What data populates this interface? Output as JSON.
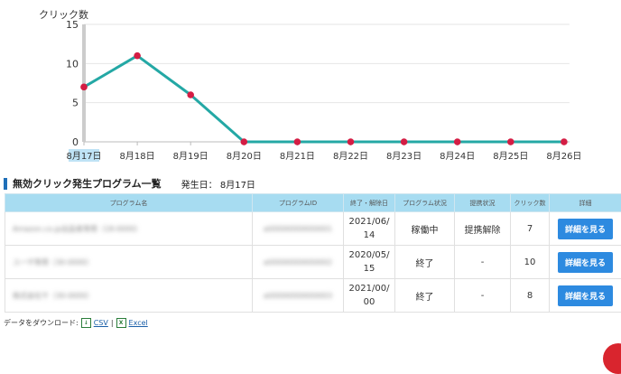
{
  "chart_data": {
    "type": "line",
    "ylabel": "クリック数",
    "categories": [
      "8月17日",
      "8月18日",
      "8月19日",
      "8月20日",
      "8月21日",
      "8月22日",
      "8月23日",
      "8月24日",
      "8月25日",
      "8月26日"
    ],
    "values": [
      7,
      11,
      6,
      0,
      0,
      0,
      0,
      0,
      0,
      0
    ],
    "ylim": [
      0,
      15
    ],
    "yticks": [
      0,
      5,
      10,
      15
    ],
    "grid": true,
    "colors": {
      "line": "#24a8a5",
      "point": "#d41d44",
      "highlight": "#bfe3f5"
    }
  },
  "section": {
    "title": "無効クリック発生プログラム一覧",
    "date_label": "発生日： 8月17日"
  },
  "table": {
    "headers": [
      "プログラム名",
      "プログラムID",
      "終了・解除日",
      "プログラム状況",
      "提携状況",
      "クリック数",
      "詳細"
    ],
    "rows": [
      {
        "name": "Amazon.co.jp出品者専用（18-0000）",
        "id": "a00000000000001",
        "end": "2021/06/14",
        "status": "稼働中",
        "partner": "提携解除",
        "clicks": "7",
        "button": "詳細を見る"
      },
      {
        "name": "ユーザ専用（30-0000）",
        "id": "a00000000000002",
        "end": "2020/05/15",
        "status": "終了",
        "partner": "-",
        "clicks": "10",
        "button": "詳細を見る"
      },
      {
        "name": "株式会社サ（30-0000）",
        "id": "a00000000000003",
        "end": "2021/00/00",
        "status": "終了",
        "partner": "-",
        "clicks": "8",
        "button": "詳細を見る"
      }
    ]
  },
  "download": {
    "label": "データをダウンロード:",
    "csv": "CSV",
    "separator": "|",
    "excel": "Excel"
  }
}
